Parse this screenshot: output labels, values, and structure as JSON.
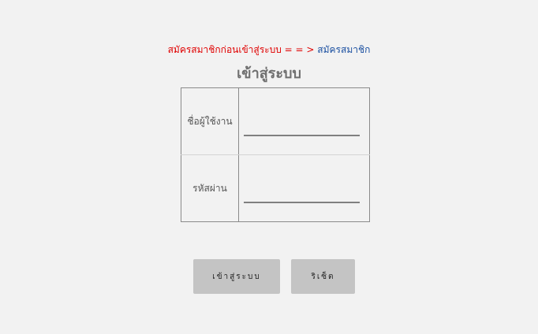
{
  "notice": {
    "warning_text": "สมัครสมาชิกก่อนเข้าสู่ระบบ = = >",
    "register_link": "สมัครสมาชิก"
  },
  "title": "เข้าสู่ระบบ",
  "form": {
    "username_label": "ชื่อผู้ใช้งาน",
    "username_value": "",
    "password_label": "รหัสผ่าน",
    "password_value": ""
  },
  "buttons": {
    "login_label": "เข้าสู่ระบบ",
    "reset_label": "ริเซ็ต"
  },
  "colors": {
    "warning": "#e00000",
    "link": "#1a4fa0",
    "button_bg": "#c4c4c4",
    "page_bg": "#f2f2f2"
  }
}
